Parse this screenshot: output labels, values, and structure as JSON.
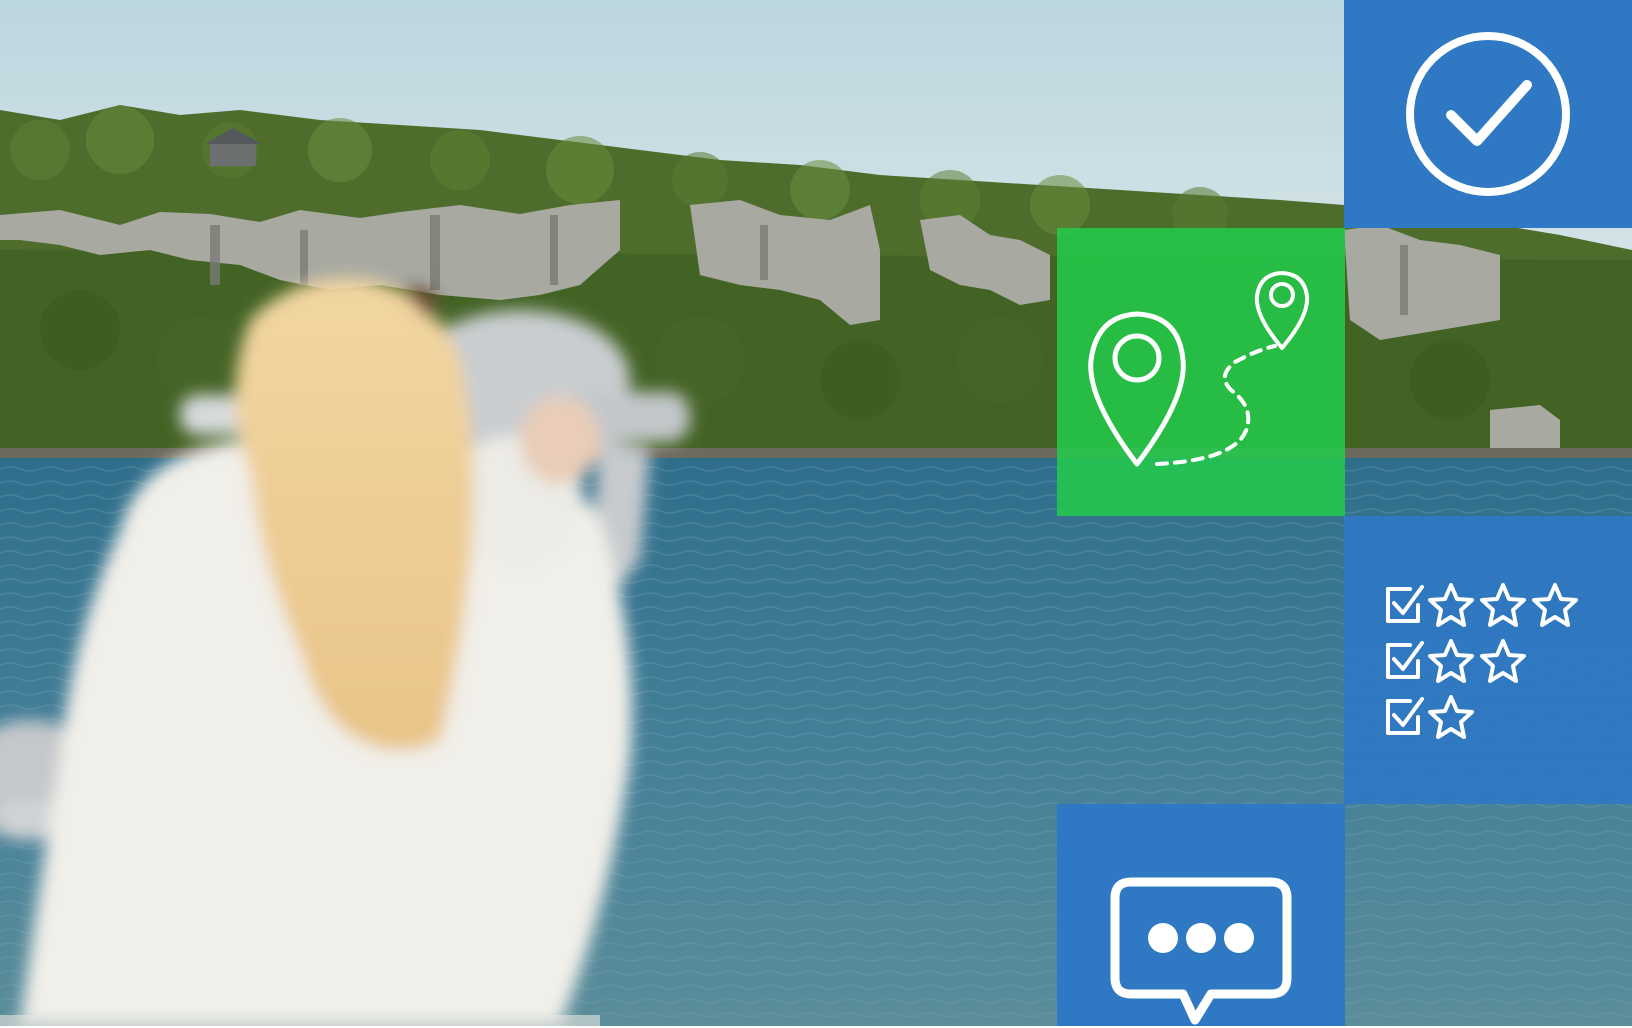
{
  "scene": {
    "description_tags": [
      "woman",
      "coin-operated-binoculars",
      "lake",
      "forested-cliffs",
      "sky"
    ]
  },
  "tiles": [
    {
      "name": "check-tile",
      "icon": "check-circle-icon",
      "color": "#2f78c4"
    },
    {
      "name": "route-tile",
      "icon": "map-route-icon",
      "color": "#22cc4a"
    },
    {
      "name": "rating-tile",
      "icon": "checklist-stars-icon",
      "color": "#2f78c4"
    },
    {
      "name": "chat-tile",
      "icon": "chat-bubble-icon",
      "color": "#2f78c4"
    }
  ],
  "colors": {
    "blue": "#2f78c4",
    "green": "#22cc4a",
    "sky": "#c6dbe2",
    "lake": "#3f7a96",
    "forest": "#4f6f2e",
    "cliff": "#9fa29a"
  }
}
